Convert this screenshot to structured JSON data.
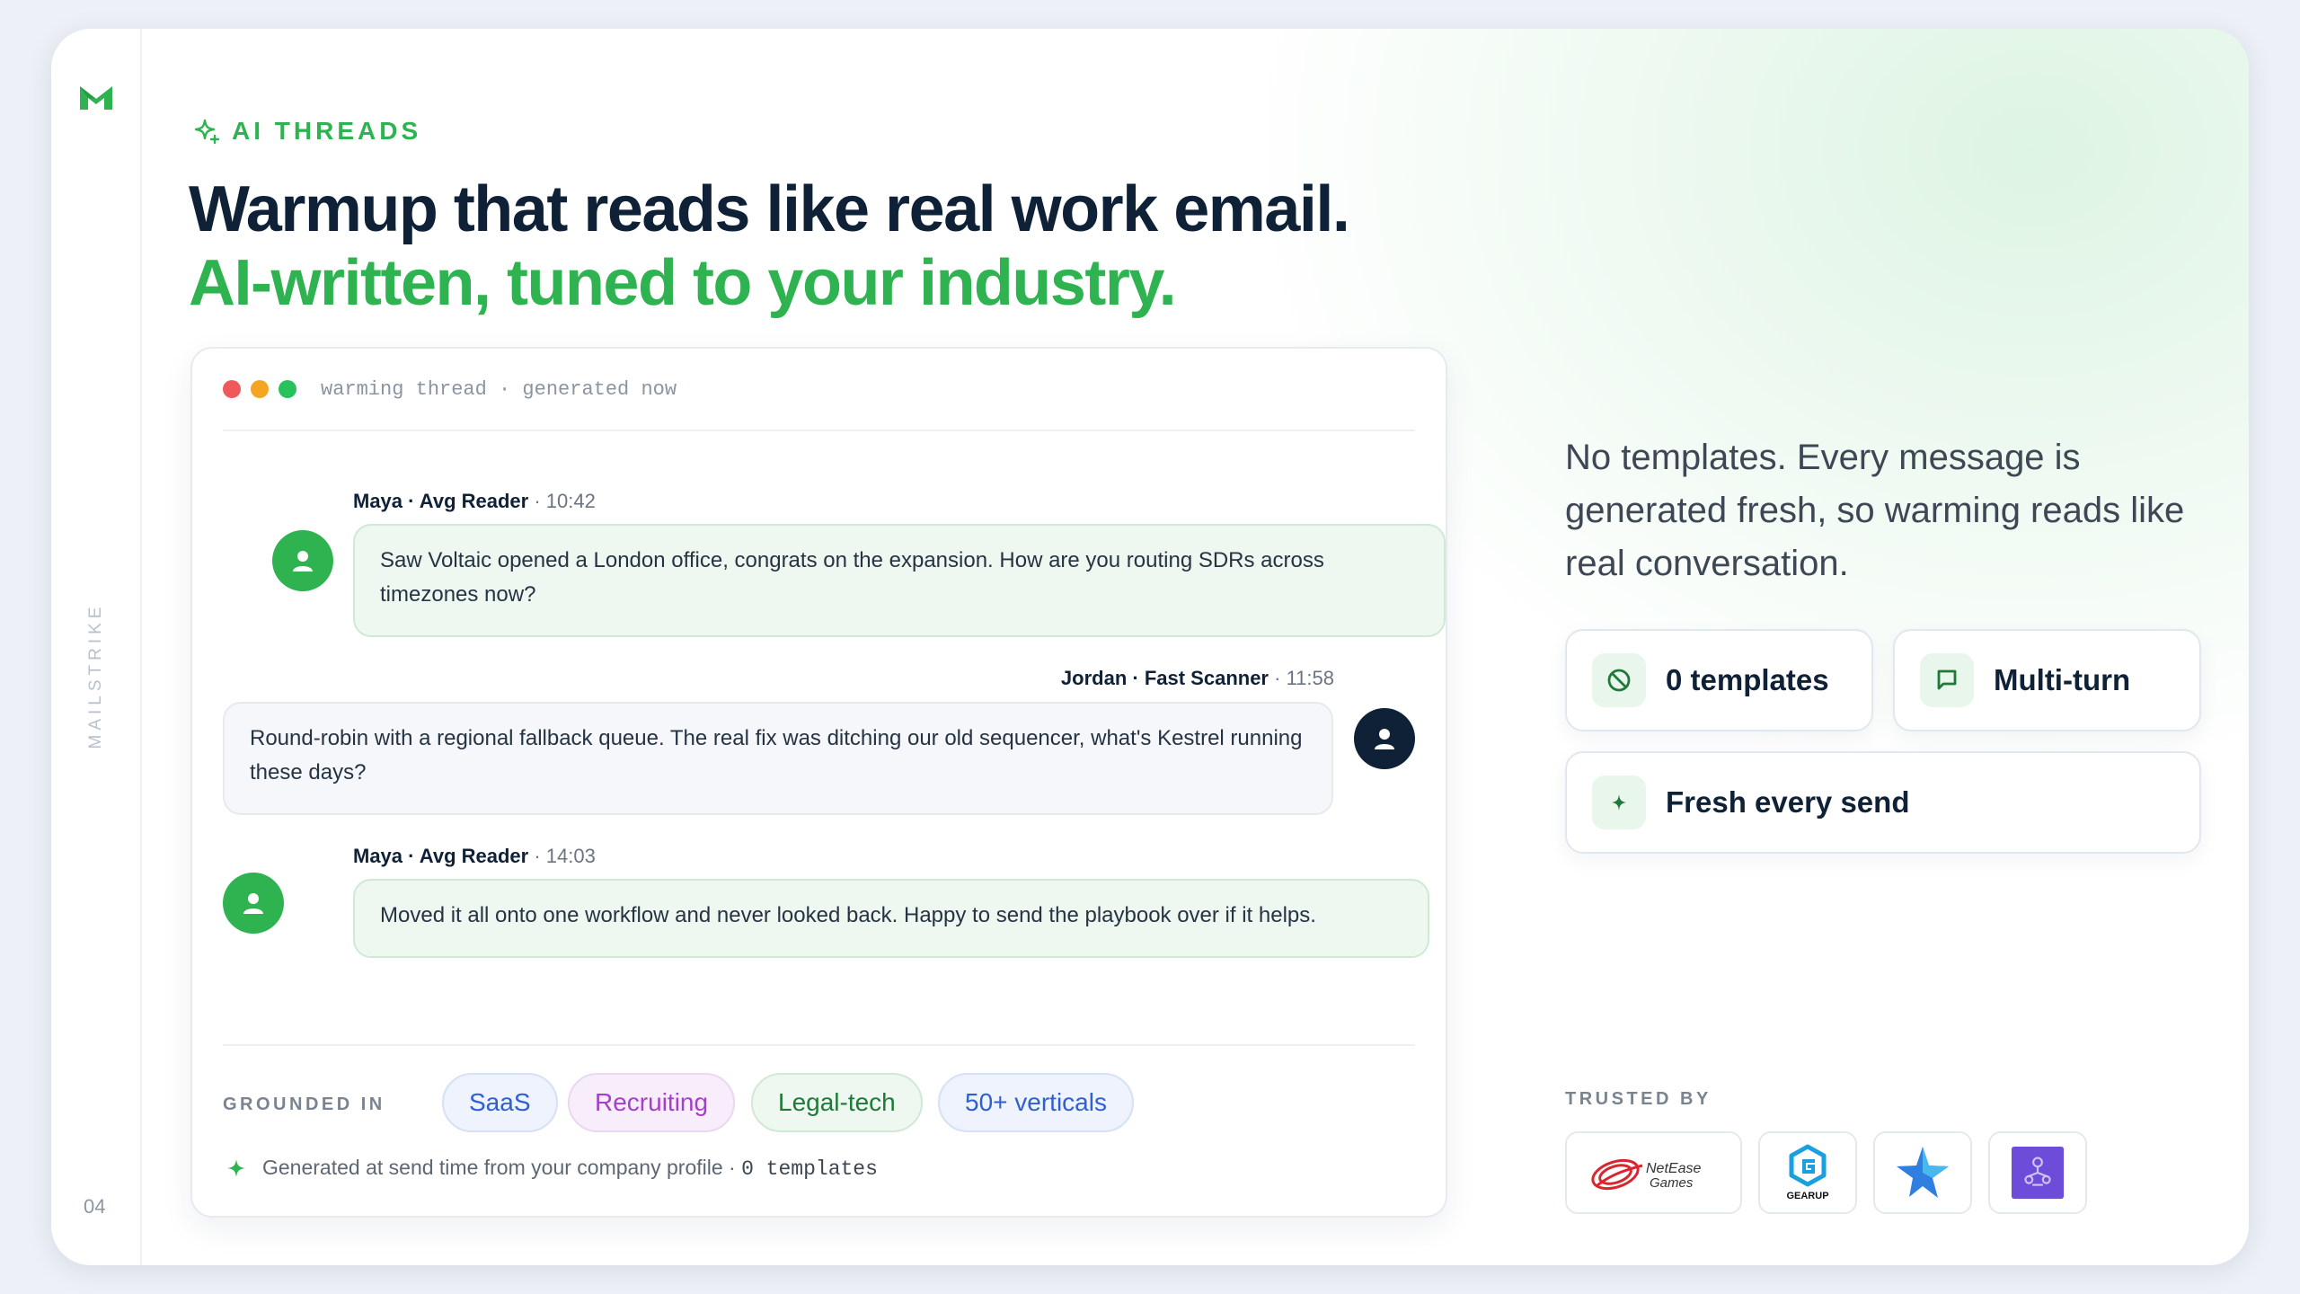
{
  "rail": {
    "brand": "MAILSTRIKE",
    "page_number": "04"
  },
  "hero": {
    "eyebrow": "AI THREADS",
    "title_line1": "Warmup that reads like real work email.",
    "title_line2": "AI-written, tuned to your industry."
  },
  "thread": {
    "meta": "warming thread · generated now",
    "messages": [
      {
        "sender": "Maya · Avg Reader",
        "time": "10:42",
        "text": "Saw Voltaic opened a London office, congrats on the expansion. How are you routing SDRs across timezones now?"
      },
      {
        "sender": "Jordan · Fast Scanner",
        "time": "11:58",
        "text": "Round-robin with a regional fallback queue. The real fix was ditching our old sequencer, what's Kestrel running these days?"
      },
      {
        "sender": "Maya · Avg Reader",
        "time": "14:03",
        "text": "Moved it all onto one workflow and never looked back. Happy to send the playbook over if it helps."
      }
    ],
    "grounded_label": "GROUNDED IN",
    "chips": [
      "SaaS",
      "Recruiting",
      "Legal-tech",
      "50+ verticals"
    ],
    "note": "Generated at send time from your company profile ·",
    "note_mono": "0 templates"
  },
  "side": {
    "lead": "No templates. Every message is generated fresh, so warming reads like real conversation.",
    "features": [
      {
        "label": "0 templates",
        "icon": "ban-icon"
      },
      {
        "label": "Multi-turn",
        "icon": "chat-icon"
      },
      {
        "label": "Fresh every send",
        "icon": "sparkle-icon"
      }
    ],
    "trusted_label": "TRUSTED BY",
    "logos": [
      {
        "name": "NetEase Games",
        "text_line1": "NetEase",
        "text_line2": "Games"
      },
      {
        "name": "GearUP",
        "text": "GEARUP"
      },
      {
        "name": "star-logo"
      },
      {
        "name": "purple-logo"
      }
    ]
  },
  "colors": {
    "accent": "#2fb350",
    "navy": "#0f2136",
    "dot_red": "#f0595c",
    "dot_yellow": "#f4a622",
    "dot_green": "#27c25b"
  }
}
